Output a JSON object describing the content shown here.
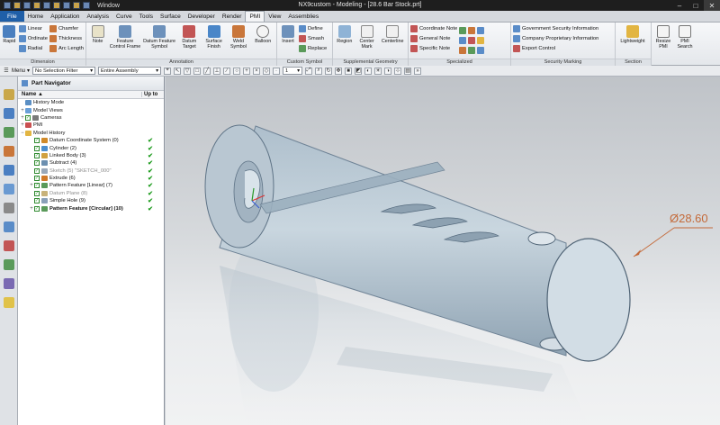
{
  "window": {
    "menu": "Window",
    "title": "NX9custom - Modeling - [28.6 Bar Stock.prt]",
    "minimize": "–",
    "maximize": "□",
    "close": "✕"
  },
  "tabs": [
    "File",
    "Home",
    "Application",
    "Analysis",
    "Curve",
    "Tools",
    "Surface",
    "Developer",
    "Render",
    "PMI",
    "View",
    "Assemblies"
  ],
  "active_tab": "PMI",
  "ribbon": {
    "dimension": {
      "label": "Dimension",
      "rapid": "Rapid",
      "linear": "Linear",
      "ordinate": "Ordinate",
      "radial": "Radial",
      "chamfer": "Chamfer",
      "thickness": "Thickness",
      "arc_length": "Arc Length"
    },
    "annotation": {
      "label": "Annotation",
      "note": "Note",
      "feature_control_frame": "Feature Control Frame",
      "datum_feature_symbol": "Datum Feature Symbol",
      "datum_target": "Datum Target",
      "surface_finish": "Surface Finish",
      "weld_symbol": "Weld Symbol",
      "balloon": "Balloon"
    },
    "custom_symbol": {
      "label": "Custom Symbol",
      "insert": "Insert",
      "define": "Define",
      "smash": "Smash",
      "replace": "Replace"
    },
    "supplemental_geometry": {
      "label": "Supplemental Geometry",
      "region": "Region",
      "center_mark": "Center Mark",
      "centerline": "Centerline"
    },
    "specialized": {
      "label": "Specialized",
      "coordinate_note": "Coordinate Note",
      "general_note": "General Note",
      "specific_note": "Specific Note"
    },
    "security_marking": {
      "label": "Security Marking",
      "government": "Government Security Information",
      "proprietary": "Company Proprietary Information",
      "export": "Export Control"
    },
    "section": {
      "label": "Section",
      "lightweight": "Lightweight"
    },
    "resize": {
      "resize_pmi": "Resize PMI",
      "pmi_search": "PMI Search"
    }
  },
  "selection_bar": {
    "menu": "Menu",
    "filter": "No Selection Filter",
    "scope": "Entire Assembly",
    "layer": "1"
  },
  "navigator": {
    "title": "Part Navigator",
    "col_name": "Name",
    "col_upto": "Up to",
    "items": [
      {
        "label": "History Mode",
        "indent": 0,
        "exp": "",
        "check": false,
        "icon": "history-icon",
        "color": "#5b8fc4",
        "upto": ""
      },
      {
        "label": "Model Views",
        "indent": 0,
        "exp": "+",
        "check": false,
        "icon": "views-icon",
        "color": "#6aa0d8",
        "upto": ""
      },
      {
        "label": "Cameras",
        "indent": 0,
        "exp": "+",
        "check": true,
        "icon": "camera-icon",
        "color": "#7a7a7a",
        "upto": ""
      },
      {
        "label": "PMI",
        "indent": 0,
        "exp": "+",
        "check": false,
        "icon": "pmi-icon",
        "color": "#c95050",
        "upto": ""
      },
      {
        "label": "Model History",
        "indent": 0,
        "exp": "−",
        "check": false,
        "icon": "folder-icon",
        "color": "#e2b542",
        "upto": ""
      },
      {
        "label": "Datum Coordinate System (0)",
        "indent": 1,
        "exp": "",
        "check": true,
        "icon": "datum-csys-icon",
        "color": "#d08a2a",
        "upto": "✔"
      },
      {
        "label": "Cylinder (2)",
        "indent": 1,
        "exp": "",
        "check": true,
        "icon": "cylinder-icon",
        "color": "#4b8fd0",
        "upto": "✔"
      },
      {
        "label": "Linked Body (3)",
        "indent": 1,
        "exp": "",
        "check": true,
        "icon": "linked-body-icon",
        "color": "#d0a040",
        "upto": "✔"
      },
      {
        "label": "Subtract (4)",
        "indent": 1,
        "exp": "",
        "check": true,
        "icon": "subtract-icon",
        "color": "#6c8fb0",
        "upto": "✔"
      },
      {
        "label": "Sketch (5) \"SKETCH_000\"",
        "indent": 1,
        "exp": "",
        "check": true,
        "icon": "sketch-icon",
        "color": "#9aa9bb",
        "upto": "✔",
        "dim": true
      },
      {
        "label": "Extrude (6)",
        "indent": 1,
        "exp": "",
        "check": true,
        "icon": "extrude-icon",
        "color": "#d07a2a",
        "upto": "✔"
      },
      {
        "label": "Pattern Feature [Linear] (7)",
        "indent": 1,
        "exp": "+",
        "check": true,
        "icon": "pattern-icon",
        "color": "#5a9a5a",
        "upto": "✔"
      },
      {
        "label": "Datum Plane (8)",
        "indent": 1,
        "exp": "",
        "check": true,
        "icon": "datum-plane-icon",
        "color": "#c8b27a",
        "upto": "✔",
        "dim": true
      },
      {
        "label": "Simple Hole (9)",
        "indent": 1,
        "exp": "",
        "check": true,
        "icon": "hole-icon",
        "color": "#8aa0b8",
        "upto": "✔"
      },
      {
        "label": "Pattern Feature [Circular] (10)",
        "indent": 1,
        "exp": "+",
        "check": true,
        "icon": "pattern-circular-icon",
        "color": "#5a9a5a",
        "upto": "✔",
        "bold": true
      }
    ]
  },
  "viewport": {
    "dimension_text": "Ø28.60"
  },
  "colors": {
    "file_tab": "#1f5fa8",
    "check_green": "#1a9a1a",
    "dimension": "#c46a3a",
    "model_blue": "#9fb3c3"
  }
}
